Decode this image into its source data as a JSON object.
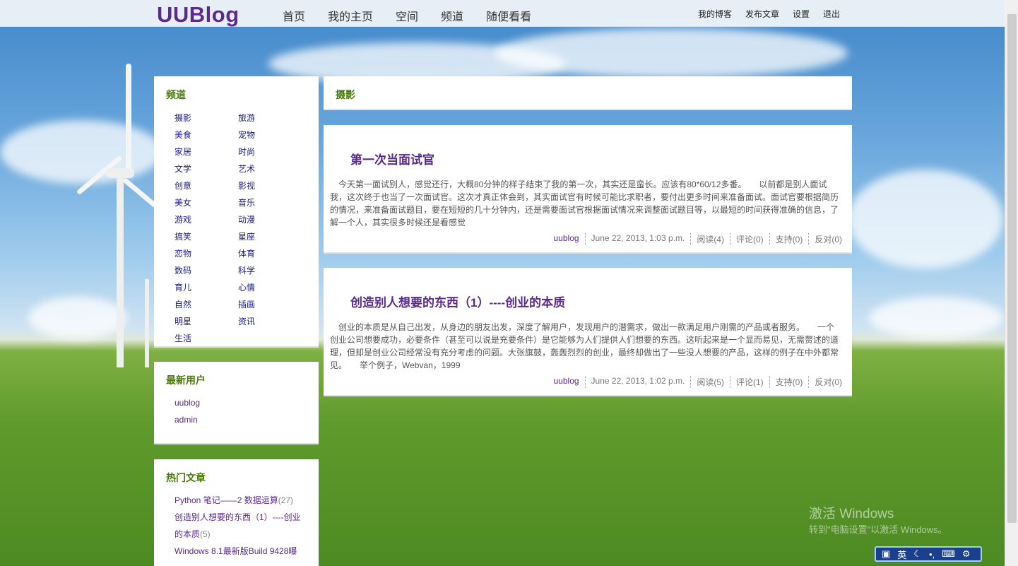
{
  "header": {
    "logo": "UUBlog",
    "nav": [
      "首页",
      "我的主页",
      "空间",
      "频道",
      "随便看看"
    ],
    "user_nav": [
      "我的博客",
      "发布文章",
      "设置",
      "退出"
    ]
  },
  "sidebar": {
    "channels_title": "频道",
    "channels": [
      "摄影",
      "旅游",
      "美食",
      "宠物",
      "家居",
      "时尚",
      "文学",
      "艺术",
      "创意",
      "影视",
      "美女",
      "音乐",
      "游戏",
      "动漫",
      "搞笑",
      "星座",
      "恋物",
      "体育",
      "数码",
      "科学",
      "育儿",
      "心情",
      "自然",
      "插画",
      "明星",
      "资讯",
      "生活"
    ],
    "new_users_title": "最新用户",
    "new_users": [
      "uublog",
      "admin"
    ],
    "hot_title": "热门文章",
    "hot_posts": [
      {
        "title": "Python 笔记——2 数据运算",
        "count": "(27)"
      },
      {
        "title": "创造别人想要的东西（1）----创业的本质",
        "count": "(5)"
      },
      {
        "title": "Windows 8.1最新版Build 9428曝",
        "count": ""
      }
    ]
  },
  "main": {
    "category_title": "摄影",
    "posts": [
      {
        "title": "第一次当面试官",
        "body": "今天第一面试别人，感觉还行，大概80分钟的样子结束了我的第一次，其实还是蛮长。应该有80*60/12多番。　　以前都是别人面试我，这次终于也当了一次面试官。这次才真正体会到，其实面试官有时候可能比求职者，要付出更多时间来准备面试。面试官要根据简历的情况，来准备面试题目，要在短短的几十分钟内，还是需要面试官根据面试情况来调整面试题目等，以最短的时间获得准确的信息，了解一个人，其实很多时候还是看感觉",
        "author": "uublog",
        "date": "June 22, 2013, 1:03 p.m.",
        "reads": "阅读(4)",
        "comments": "评论(0)",
        "support": "支持(0)",
        "oppose": "反对(0)"
      },
      {
        "title": "创造别人想要的东西（1）----创业的本质",
        "body": "创业的本质是从自己出发，从身边的朋友出发，深度了解用户，发现用户的潜需求，做出一款满足用户刚需的产品或者服务。　　一个创业公司想要成功，必要条件（甚至可以说是充要条件）是它能够为人们提供人们想要的东西。这听起来是一个显而易见，无需赘述的道理，但却是创业公司经常没有充分考虑的问题。大张旗鼓，轰轰烈烈的创业，最终却做出了一些没人想要的产品，这样的例子在中外都常见。　　举个例子，Webvan，1999",
        "author": "uublog",
        "date": "June 22, 2013, 1:02 p.m.",
        "reads": "阅读(5)",
        "comments": "评论(1)",
        "support": "支持(0)",
        "oppose": "反对(0)"
      }
    ]
  },
  "overlay": {
    "watermark_line1": "激活 Windows",
    "watermark_line2": "转到\"电脑设置\"以激活 Windows。",
    "ime_mode": "英"
  }
}
